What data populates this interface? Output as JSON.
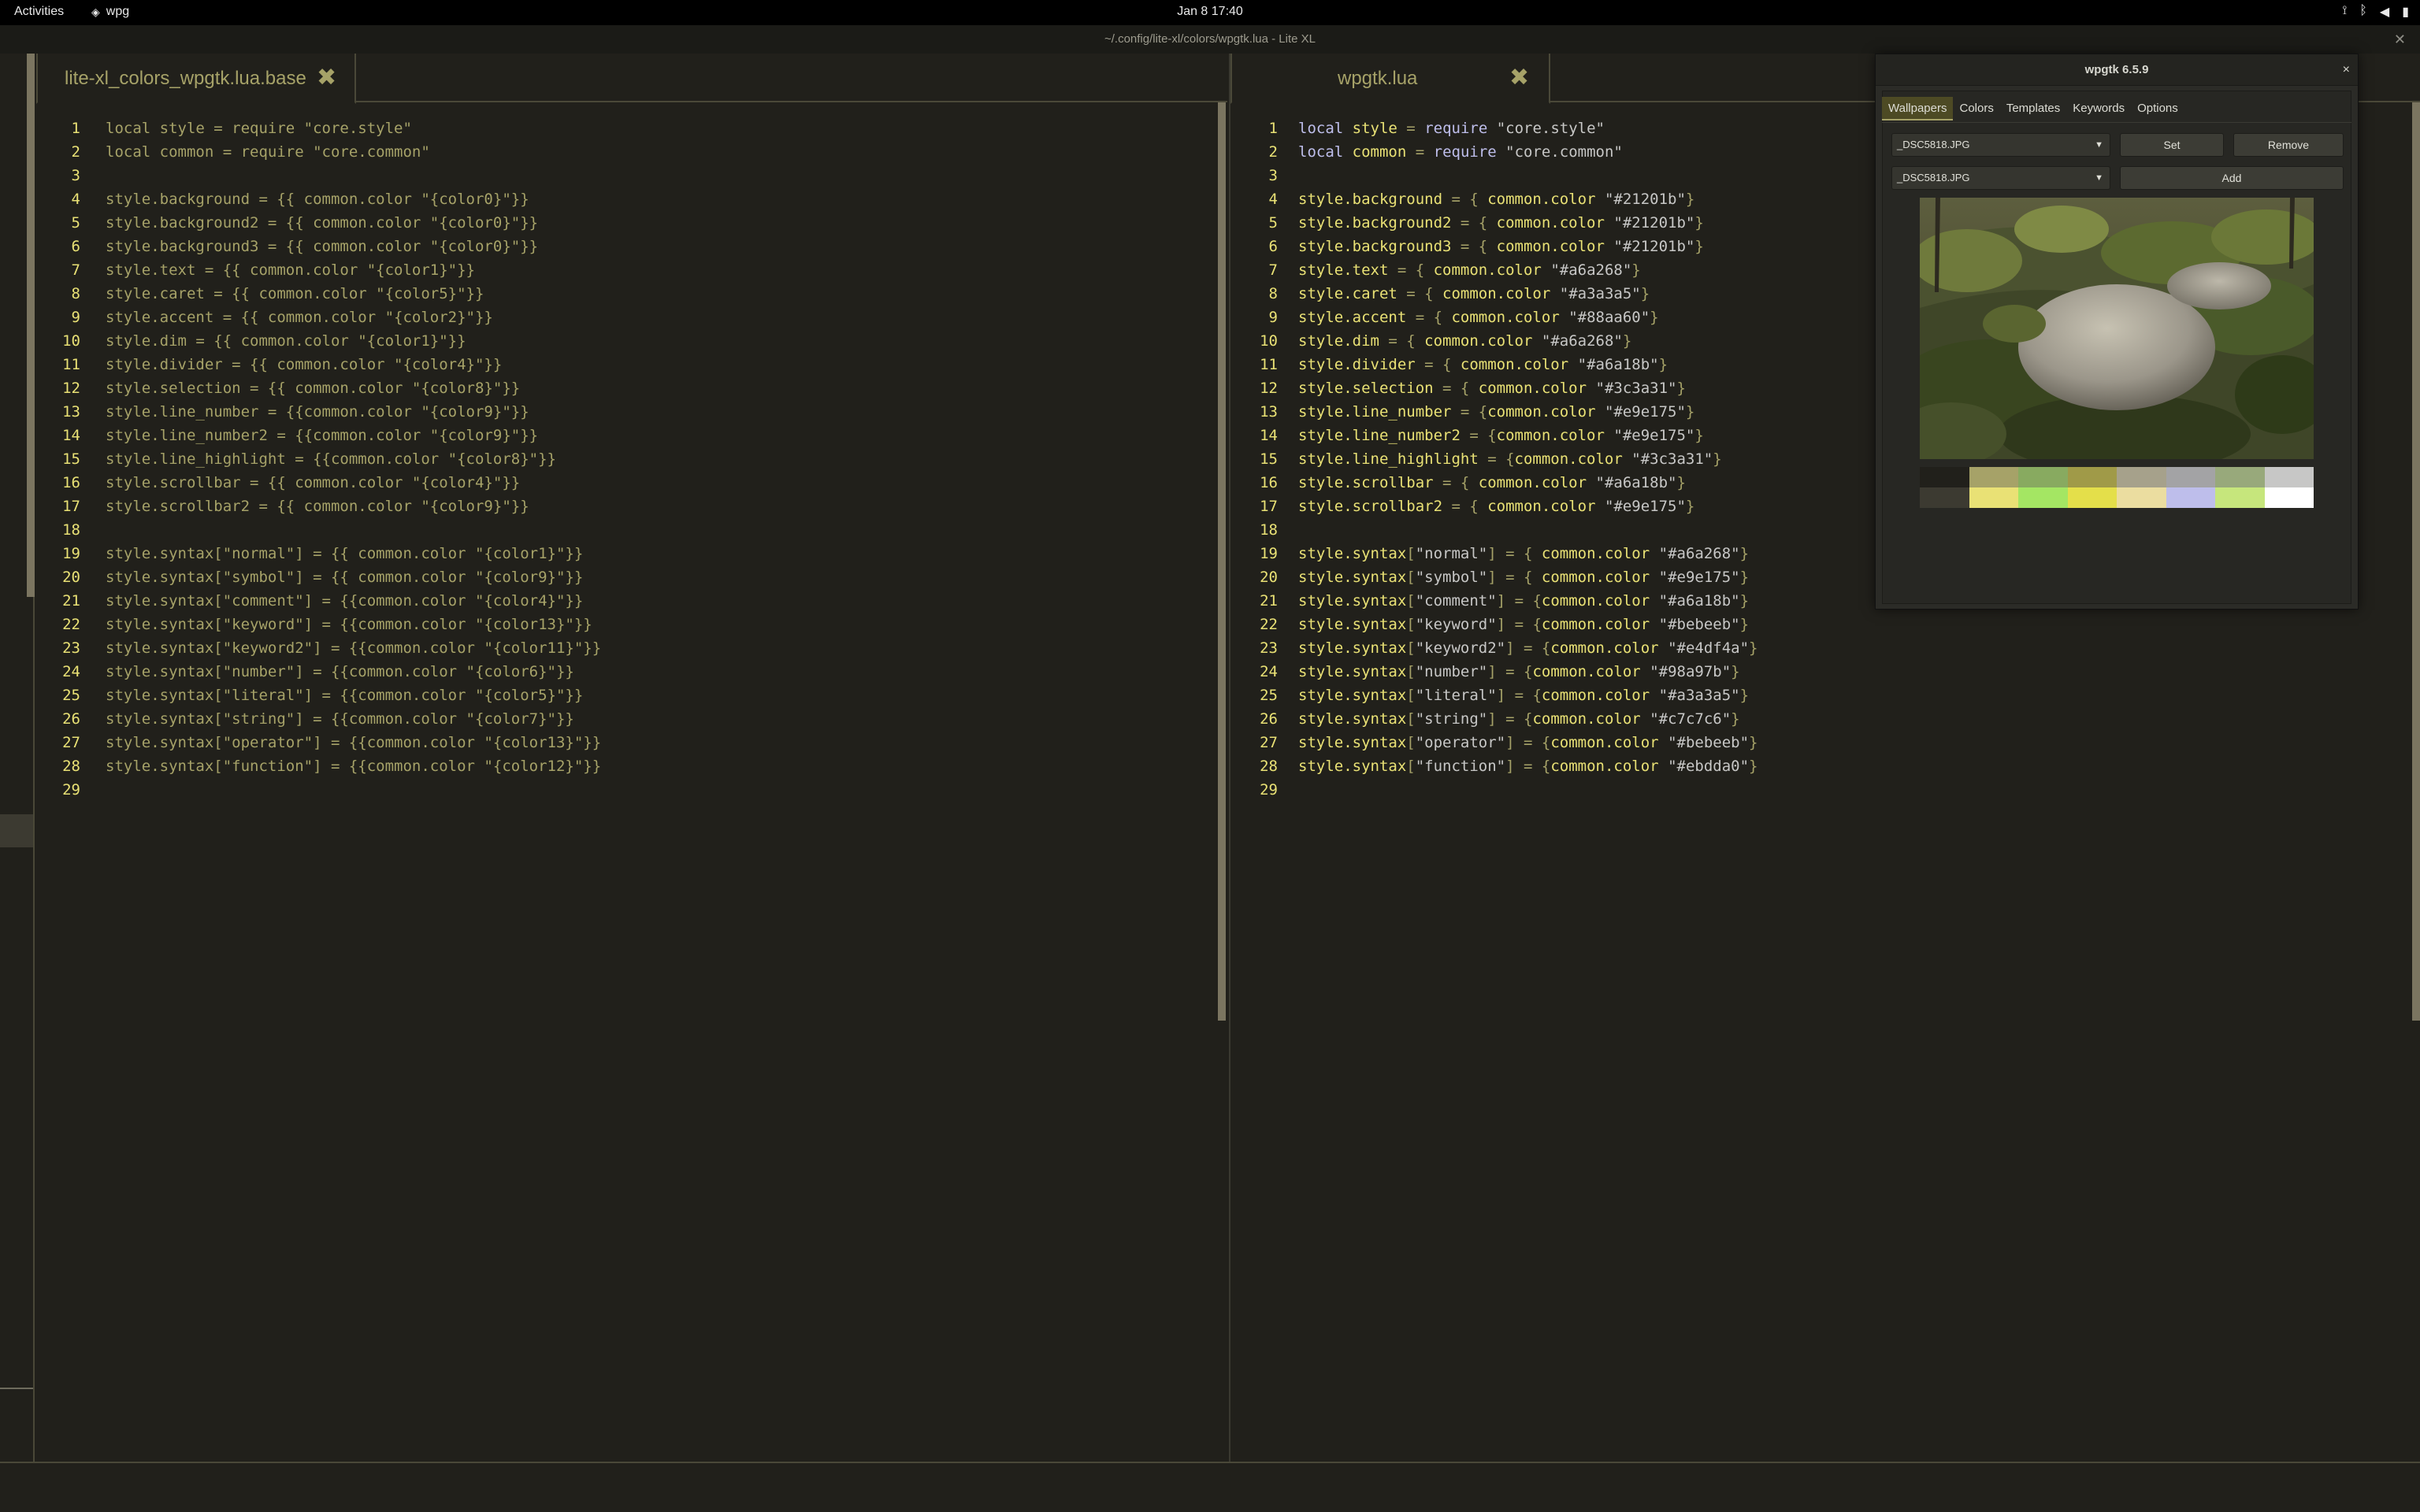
{
  "topbar": {
    "activities": "Activities",
    "app_name": "wpg",
    "clock": "Jan 8  17:40"
  },
  "window": {
    "title": "~/.config/lite-xl/colors/wpgtk.lua - Lite XL",
    "close_glyph": "✕"
  },
  "left_pane": {
    "tab_label": "lite-xl_colors_wpgtk.lua.base",
    "tab_close": "✖",
    "lines": [
      "local style = require \"core.style\"",
      "local common = require \"core.common\"",
      "",
      "style.background = {{ common.color \"{color0}\"}}",
      "style.background2 = {{ common.color \"{color0}\"}}",
      "style.background3 = {{ common.color \"{color0}\"}}",
      "style.text = {{ common.color \"{color1}\"}}",
      "style.caret = {{ common.color \"{color5}\"}}",
      "style.accent = {{ common.color \"{color2}\"}}",
      "style.dim = {{ common.color \"{color1}\"}}",
      "style.divider = {{ common.color \"{color4}\"}}",
      "style.selection = {{ common.color \"{color8}\"}}",
      "style.line_number = {{common.color \"{color9}\"}}",
      "style.line_number2 = {{common.color \"{color9}\"}}",
      "style.line_highlight = {{common.color \"{color8}\"}}",
      "style.scrollbar = {{ common.color \"{color4}\"}}",
      "style.scrollbar2 = {{ common.color \"{color9}\"}}",
      "",
      "style.syntax[\"normal\"] = {{ common.color \"{color1}\"}}",
      "style.syntax[\"symbol\"] = {{ common.color \"{color9}\"}}",
      "style.syntax[\"comment\"] = {{common.color \"{color4}\"}}",
      "style.syntax[\"keyword\"] = {{common.color \"{color13}\"}}",
      "style.syntax[\"keyword2\"] = {{common.color \"{color11}\"}}",
      "style.syntax[\"number\"] = {{common.color \"{color6}\"}}",
      "style.syntax[\"literal\"] = {{common.color \"{color5}\"}}",
      "style.syntax[\"string\"] = {{common.color \"{color7}\"}}",
      "style.syntax[\"operator\"] = {{common.color \"{color13}\"}}",
      "style.syntax[\"function\"] = {{common.color \"{color12}\"}}",
      ""
    ]
  },
  "right_pane": {
    "tab_label": "wpgtk.lua",
    "tab_close": "✖",
    "lines": [
      "local style = require \"core.style\"",
      "local common = require \"core.common\"",
      "",
      "style.background = { common.color \"#21201b\"}",
      "style.background2 = { common.color \"#21201b\"}",
      "style.background3 = { common.color \"#21201b\"}",
      "style.text = { common.color \"#a6a268\"}",
      "style.caret = { common.color \"#a3a3a5\"}",
      "style.accent = { common.color \"#88aa60\"}",
      "style.dim = { common.color \"#a6a268\"}",
      "style.divider = { common.color \"#a6a18b\"}",
      "style.selection = { common.color \"#3c3a31\"}",
      "style.line_number = {common.color \"#e9e175\"}",
      "style.line_number2 = {common.color \"#e9e175\"}",
      "style.line_highlight = {common.color \"#3c3a31\"}",
      "style.scrollbar = { common.color \"#a6a18b\"}",
      "style.scrollbar2 = { common.color \"#e9e175\"}",
      "",
      "style.syntax[\"normal\"] = { common.color \"#a6a268\"}",
      "style.syntax[\"symbol\"] = { common.color \"#e9e175\"}",
      "style.syntax[\"comment\"] = {common.color \"#a6a18b\"}",
      "style.syntax[\"keyword\"] = {common.color \"#bebeeb\"}",
      "style.syntax[\"keyword2\"] = {common.color \"#e4df4a\"}",
      "style.syntax[\"number\"] = {common.color \"#98a97b\"}",
      "style.syntax[\"literal\"] = {common.color \"#a3a3a5\"}",
      "style.syntax[\"string\"] = {common.color \"#c7c7c6\"}",
      "style.syntax[\"operator\"] = {common.color \"#bebeeb\"}",
      "style.syntax[\"function\"] = {common.color \"#ebdda0\"}",
      ""
    ]
  },
  "wpgtk": {
    "title": "wpgtk 6.5.9",
    "close_glyph": "×",
    "tabs": [
      "Wallpapers",
      "Colors",
      "Templates",
      "Keywords",
      "Options"
    ],
    "active_tab": "Wallpapers",
    "wallpaper_select": "_DSC5818.JPG",
    "add_select": "_DSC5818.JPG",
    "set_button": "Set",
    "remove_button": "Remove",
    "add_button": "Add",
    "palette": [
      "#21201b",
      "#a6a268",
      "#88aa60",
      "#a09a48",
      "#a6a18b",
      "#a3a3a5",
      "#98a97b",
      "#c7c7c6",
      "#3c3a31",
      "#e9e175",
      "#a4e663",
      "#e4df4a",
      "#ebdda0",
      "#bebeeb",
      "#c6e67c",
      "#ffffff"
    ]
  },
  "colors": {
    "background": "#21201b",
    "text": "#a6a268",
    "line_number": "#e9e175",
    "keyword": "#bebeeb",
    "string": "#c7c7c6",
    "divider": "#4a4838"
  }
}
